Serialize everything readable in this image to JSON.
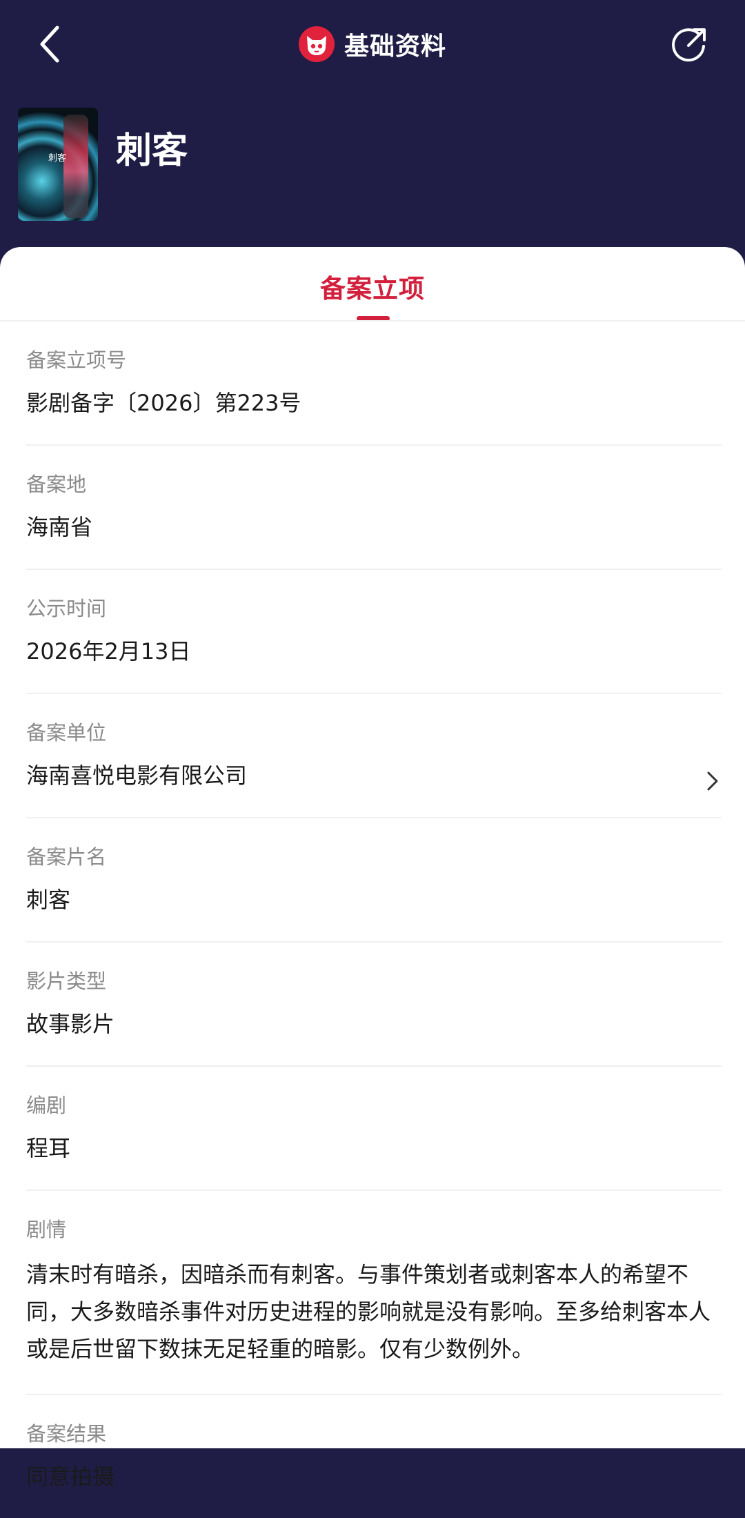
{
  "header": {
    "title": "基础资料",
    "icons": {
      "back": "chevron-left-icon",
      "logo": "cat-logo-icon",
      "share": "share-icon"
    },
    "colors": {
      "background": "#1f1d45",
      "brand": "#e0223c"
    }
  },
  "movie": {
    "title": "刺客",
    "poster_text": "刺客"
  },
  "tabs": [
    {
      "label": "备案立项",
      "active": true
    }
  ],
  "accent_color": "#d21f3c",
  "fields": [
    {
      "label": "备案立项号",
      "value": "影剧备字〔2026〕第223号"
    },
    {
      "label": "备案地",
      "value": "海南省"
    },
    {
      "label": "公示时间",
      "value": "2026年2月13日"
    },
    {
      "label": "备案单位",
      "value": "海南喜悦电影有限公司",
      "link": true
    },
    {
      "label": "备案片名",
      "value": "刺客"
    },
    {
      "label": "影片类型",
      "value": "故事影片"
    },
    {
      "label": "编剧",
      "value": "程耳"
    },
    {
      "label": "剧情",
      "value": "清末时有暗杀，因暗杀而有刺客。与事件策划者或刺客本人的希望不同，大多数暗杀事件对历史进程的影响就是没有影响。至多给刺客本人或是后世留下数抹无足轻重的暗影。仅有少数例外。"
    },
    {
      "label": "备案结果",
      "value": "同意拍摄"
    }
  ]
}
